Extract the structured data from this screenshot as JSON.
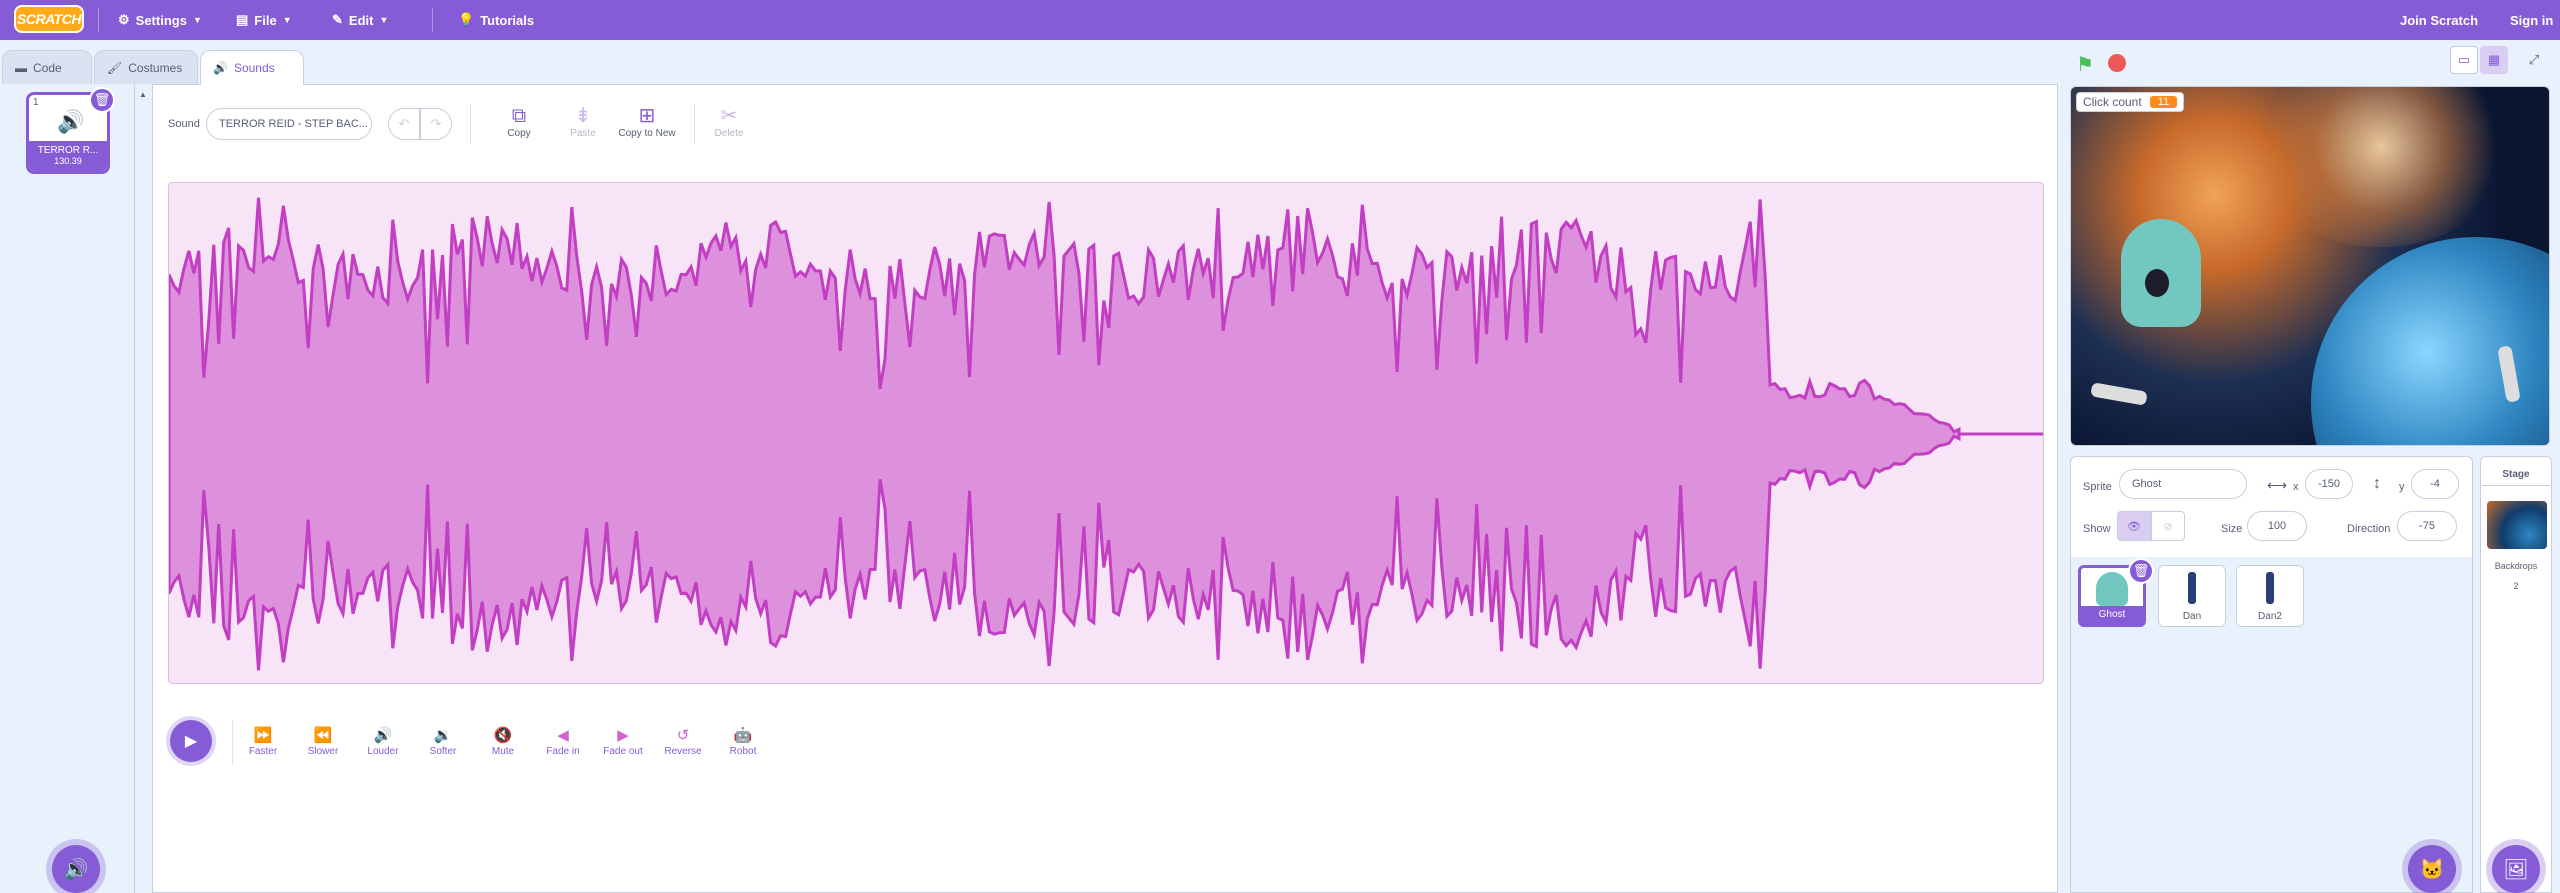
{
  "menubar": {
    "logo": "SCRATCH",
    "settings": "Settings",
    "file": "File",
    "edit": "Edit",
    "tutorials": "Tutorials",
    "join": "Join Scratch",
    "signin": "Sign in"
  },
  "tabs": {
    "code": "Code",
    "costumes": "Costumes",
    "sounds": "Sounds"
  },
  "sound_list": {
    "items": [
      {
        "index": "1",
        "name": "TERROR R...",
        "duration": "130.39"
      }
    ]
  },
  "editor": {
    "sound_label": "Sound",
    "sound_name": "TERROR REID - STEP BAC...",
    "tools": {
      "copy": "Copy",
      "paste": "Paste",
      "copy_to_new": "Copy to New",
      "delete": "Delete"
    },
    "effects": [
      "Faster",
      "Slower",
      "Louder",
      "Softer",
      "Mute",
      "Fade in",
      "Fade out",
      "Reverse",
      "Robot"
    ]
  },
  "stage": {
    "monitor_label": "Click count",
    "monitor_value": "11"
  },
  "sprite_info": {
    "sprite_label": "Sprite",
    "sprite_name": "Ghost",
    "x_label": "x",
    "x_value": "-150",
    "y_label": "y",
    "y_value": "-4",
    "show_label": "Show",
    "size_label": "Size",
    "size_value": "100",
    "direction_label": "Direction",
    "direction_value": "-75"
  },
  "sprites": [
    "Ghost",
    "Dan",
    "Dan2"
  ],
  "stage_panel": {
    "title": "Stage",
    "backdrops_label": "Backdrops",
    "backdrops_count": "2"
  },
  "colors": {
    "accent": "#855cd6",
    "sound": "#cf63cf",
    "monitor": "#ff8c1a",
    "green_flag": "#4cbf56",
    "stop": "#ec5959"
  }
}
